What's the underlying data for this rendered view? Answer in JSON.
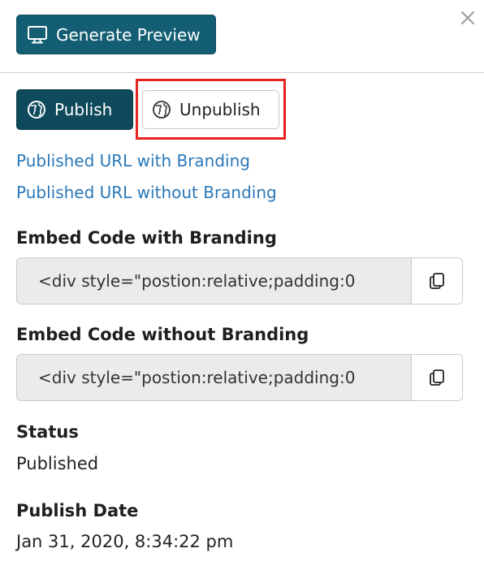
{
  "header": {
    "generate_preview_label": "Generate Preview",
    "generate_preview_icon": "monitor-icon",
    "close_icon": "close-icon"
  },
  "publish_actions": {
    "publish_label": "Publish",
    "unpublish_label": "Unpublish",
    "globe_icon": "globe-icon",
    "highlight_color": "#e8231e"
  },
  "links": {
    "with_branding": "Published URL with Branding",
    "without_branding": "Published URL without Branding"
  },
  "embed_with_branding": {
    "heading": "Embed Code with Branding",
    "value": "<div style=\"postion:relative;padding:0",
    "copy_icon": "copy-icon"
  },
  "embed_without_branding": {
    "heading": "Embed Code without Branding",
    "value": "<div style=\"postion:relative;padding:0",
    "copy_icon": "copy-icon"
  },
  "status": {
    "heading": "Status",
    "value": "Published"
  },
  "publish_date": {
    "heading": "Publish Date",
    "value": "Jan 31, 2020, 8:34:22 pm"
  },
  "colors": {
    "primary": "#135e72",
    "primary_dark": "#0e4a5b",
    "link": "#2a78b8"
  }
}
